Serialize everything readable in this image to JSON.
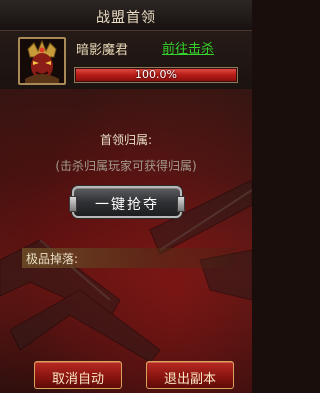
{
  "window": {
    "title": "战盟首领"
  },
  "boss": {
    "name": "暗影魔君",
    "goto_label": "前往击杀",
    "hp_text": "100.0%",
    "hp_fraction": 1.0,
    "portrait_icon": "demon-portrait-icon"
  },
  "ownership": {
    "label": "首领归属:",
    "hint": "(击杀归属玩家可获得归属)",
    "grab_label": "一键抢夺"
  },
  "drops": {
    "header": "极品掉落:"
  },
  "footer": {
    "cancel_auto_label": "取消自动",
    "exit_dungeon_label": "退出副本"
  },
  "colors": {
    "link_green": "#35d22a",
    "hp_red": "#b61c17",
    "button_red": "#8a1510",
    "gold_border": "#d6a55c"
  }
}
